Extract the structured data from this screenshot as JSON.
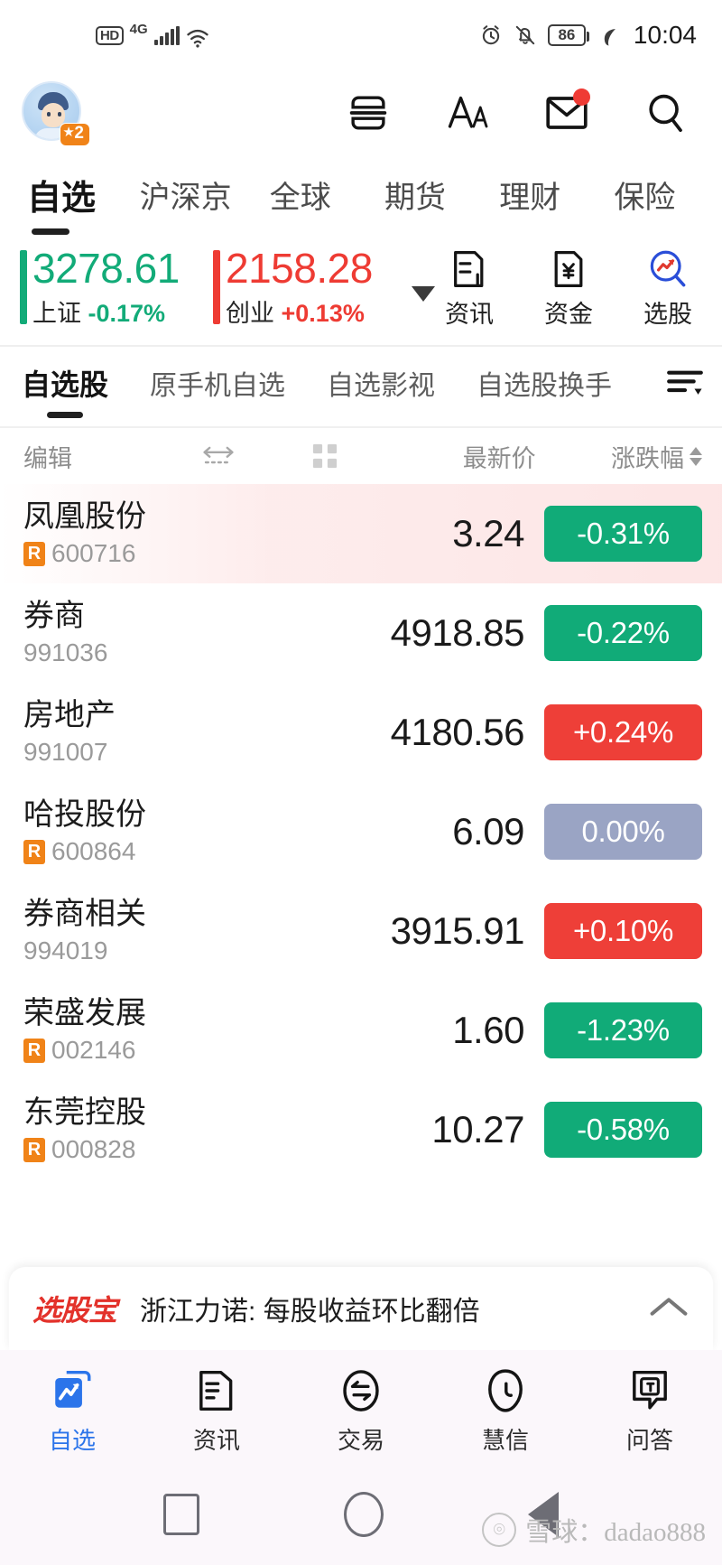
{
  "status_bar": {
    "hd_label": "HD",
    "network": "4G",
    "battery": "86",
    "time": "10:04",
    "icons": [
      "signal-bars-icon",
      "wifi-icon",
      "alarm-clock-icon",
      "bell-muted-icon",
      "battery-icon",
      "power-saving-leaf-icon"
    ]
  },
  "header": {
    "avatar_level": "2",
    "icons": [
      "scan-code-icon",
      "font-size-icon",
      "mail-icon",
      "search-icon"
    ],
    "mail_has_badge": true
  },
  "top_tabs": [
    {
      "label": "自选",
      "active": true
    },
    {
      "label": "沪深京",
      "active": false
    },
    {
      "label": "全球",
      "active": false
    },
    {
      "label": "期货",
      "active": false
    },
    {
      "label": "理财",
      "active": false
    },
    {
      "label": "保险",
      "active": false
    }
  ],
  "indices": [
    {
      "value": "3278.61",
      "name": "上证",
      "change": "-0.17%",
      "direction": "down",
      "color": "#12ab78"
    },
    {
      "value": "2158.28",
      "name": "创业",
      "change": "+0.13%",
      "direction": "up",
      "color": "#ee3b33"
    }
  ],
  "quick_actions": [
    {
      "label": "资讯",
      "icon": "news-document-icon"
    },
    {
      "label": "资金",
      "icon": "fund-yen-icon"
    },
    {
      "label": "选股",
      "icon": "stock-picker-magnifier-icon"
    }
  ],
  "sub_tabs": [
    {
      "label": "自选股",
      "active": true
    },
    {
      "label": "原手机自选",
      "active": false
    },
    {
      "label": "自选影视",
      "active": false
    },
    {
      "label": "自选股换手",
      "active": false
    }
  ],
  "sub_tabs_sort_icon": "list-sort-icon",
  "column_headers": {
    "edit": "编辑",
    "reorder_icon": "horizontal-arrows-icon",
    "grid_icon": "grid-view-icon",
    "price": "最新价",
    "change": "涨跌幅",
    "sort_icon": "sort-arrows-icon"
  },
  "stocks": [
    {
      "name": "凤凰股份",
      "code": "600716",
      "r_tag": "R",
      "price": "3.24",
      "change": "-0.31%",
      "direction": "down",
      "flash": true
    },
    {
      "name": "券商",
      "code": "991036",
      "r_tag": "",
      "price": "4918.85",
      "change": "-0.22%",
      "direction": "down",
      "flash": false
    },
    {
      "name": "房地产",
      "code": "991007",
      "r_tag": "",
      "price": "4180.56",
      "change": "+0.24%",
      "direction": "up",
      "flash": false
    },
    {
      "name": "哈投股份",
      "code": "600864",
      "r_tag": "R",
      "price": "6.09",
      "change": "0.00%",
      "direction": "flat",
      "flash": false
    },
    {
      "name": "券商相关",
      "code": "994019",
      "r_tag": "",
      "price": "3915.91",
      "change": "+0.10%",
      "direction": "up",
      "flash": false
    },
    {
      "name": "荣盛发展",
      "code": "002146",
      "r_tag": "R",
      "price": "1.60",
      "change": "-1.23%",
      "direction": "down",
      "flash": false
    },
    {
      "name": "东莞控股",
      "code": "000828",
      "r_tag": "R",
      "price": "10.27",
      "change": "-0.58%",
      "direction": "down",
      "flash": false
    }
  ],
  "promo": {
    "logo": "选股宝",
    "text": "浙江力诺: 每股收益环比翻倍",
    "collapse_icon": "chevron-up-icon"
  },
  "bottom_nav": [
    {
      "label": "自选",
      "icon": "watchlist-chart-icon",
      "active": true
    },
    {
      "label": "资讯",
      "icon": "news-document-icon",
      "active": false
    },
    {
      "label": "交易",
      "icon": "trade-exchange-icon",
      "active": false
    },
    {
      "label": "慧信",
      "icon": "huixin-icon",
      "active": false
    },
    {
      "label": "问答",
      "icon": "qa-speech-icon",
      "active": false
    }
  ],
  "system_nav": [
    "recents-square-icon",
    "home-circle-icon",
    "back-triangle-icon"
  ],
  "watermark": "雪球：dadao888",
  "colors": {
    "down_green": "#11ab78",
    "up_red": "#ee3f38",
    "flat_gray": "#9aa4c4",
    "accent_blue": "#2b74ea",
    "tag_orange": "#f08318",
    "promo_red": "#e3322b"
  }
}
